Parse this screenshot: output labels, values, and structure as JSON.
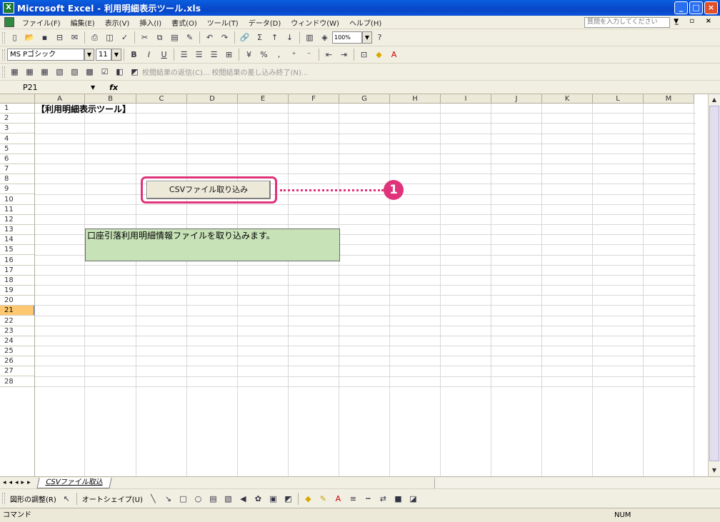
{
  "window": {
    "title": "Microsoft Excel - 利用明細表示ツール.xls",
    "app_icon_letter": "X"
  },
  "menu": {
    "items": [
      "ファイル(F)",
      "編集(E)",
      "表示(V)",
      "挿入(I)",
      "書式(O)",
      "ツール(T)",
      "データ(D)",
      "ウィンドウ(W)",
      "ヘルプ(H)"
    ],
    "help_placeholder": "質問を入力してください"
  },
  "toolbar": {
    "zoom": "100%",
    "font_name": "MS Pゴシック",
    "font_size": "11",
    "review_text": "校閲結果の返信(C)... 校閲結果の差し込み終了(N)..."
  },
  "formula_bar": {
    "name_box": "P21",
    "fx": "fx"
  },
  "columns": [
    "A",
    "B",
    "C",
    "D",
    "E",
    "F",
    "G",
    "H",
    "I",
    "J",
    "K",
    "L",
    "M"
  ],
  "rows": [
    "1",
    "2",
    "3",
    "4",
    "5",
    "6",
    "7",
    "8",
    "9",
    "10",
    "11",
    "12",
    "13",
    "14",
    "15",
    "16",
    "17",
    "18",
    "19",
    "20",
    "21",
    "22",
    "23",
    "24",
    "25",
    "26",
    "27",
    "28"
  ],
  "selected_row": "21",
  "cells": {
    "a1": "【利用明細表示ツール】",
    "note": "口座引落利用明細情報ファイルを取り込みます。"
  },
  "csv_button": {
    "label": "CSVファイル取り込み"
  },
  "callout": {
    "number": "1"
  },
  "sheet_tabs": {
    "active": "CSVファイル取込"
  },
  "drawing_bar": {
    "draw_label": "図形の調整(R)",
    "autoshape_label": "オートシェイプ(U)"
  },
  "status": {
    "mode": "コマンド",
    "num": "NUM"
  },
  "colors": {
    "accent": "#e0337a",
    "note_fill": "#c8e2b8",
    "title_bar": "#0a5fe0"
  }
}
